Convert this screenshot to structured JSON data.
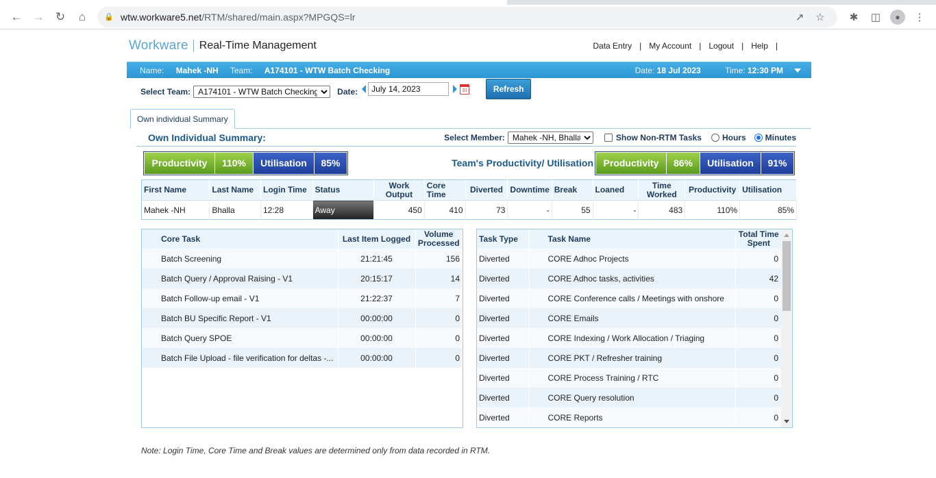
{
  "browser": {
    "url_host": "wtw.workware5.net",
    "url_path": "/RTM/shared/main.aspx?MPGQS=lr"
  },
  "header": {
    "logo": "Workware",
    "product": "Real-Time Management",
    "nav": [
      "Data Entry",
      "My Account",
      "Logout",
      "Help"
    ]
  },
  "infobar": {
    "name_label": "Name:",
    "name_value": "Mahek -NH",
    "team_label": "Team:",
    "team_value": "A174101 - WTW Batch Checking",
    "date_label": "Date:",
    "date_value": "18 Jul 2023",
    "time_label": "Time:",
    "time_value": "12:30 PM"
  },
  "filters": {
    "team_label": "Select Team:",
    "team_value": "A174101 - WTW Batch Checking",
    "date_label": "Date:",
    "date_value": "July 14, 2023",
    "calendar_day": "31",
    "refresh_label": "Refresh"
  },
  "tab": {
    "label": "Own individual Summary"
  },
  "summary": {
    "title": "Own Individual Summary:",
    "member_label": "Select Member:",
    "member_value": "Mahek -NH, Bhalla",
    "non_rtm_label": "Show Non-RTM Tasks",
    "hours_label": "Hours",
    "minutes_label": "Minutes"
  },
  "kpi": {
    "own": {
      "prod_label": "Productivity",
      "prod_value": "110%",
      "util_label": "Utilisation",
      "util_value": "85%"
    },
    "team_label": "Team's Productivity/ Utilisation",
    "team": {
      "prod_label": "Productivity",
      "prod_value": "86%",
      "util_label": "Utilisation",
      "util_value": "91%"
    }
  },
  "main_table": {
    "headers": [
      "First Name",
      "Last Name",
      "Login Time",
      "Status",
      "Work Output",
      "Core Time",
      "Diverted",
      "Downtime",
      "Break",
      "Loaned",
      "Time Worked",
      "Productivity",
      "Utilisation"
    ],
    "row": [
      "Mahek -NH",
      "Bhalla",
      "12:28",
      "Away",
      "450",
      "410",
      "73",
      "-",
      "55",
      "-",
      "483",
      "110%",
      "85%"
    ]
  },
  "core_tasks": {
    "headers": [
      "Core Task",
      "Last Item Logged",
      "Volume Processed"
    ],
    "rows": [
      [
        "Batch Screening",
        "21:21:45",
        "156"
      ],
      [
        "Batch Query / Approval Raising - V1",
        "20:15:17",
        "14"
      ],
      [
        "Batch Follow-up email - V1",
        "21:22:37",
        "7"
      ],
      [
        "Batch BU Specific Report - V1",
        "00:00:00",
        "0"
      ],
      [
        "Batch Query SPOE",
        "00:00:00",
        "0"
      ],
      [
        "Batch File Upload - file verification for deltas -...",
        "00:00:00",
        "0"
      ]
    ]
  },
  "diverted_tasks": {
    "headers": [
      "Task Type",
      "Task Name",
      "Total Time Spent"
    ],
    "rows": [
      [
        "Diverted",
        "CORE Adhoc Projects",
        "0"
      ],
      [
        "Diverted",
        "CORE Adhoc tasks, activities",
        "42"
      ],
      [
        "Diverted",
        "CORE Conference calls / Meetings with onshore",
        "0"
      ],
      [
        "Diverted",
        "CORE Emails",
        "0"
      ],
      [
        "Diverted",
        "CORE Indexing / Work Allocation / Triaging",
        "0"
      ],
      [
        "Diverted",
        "CORE PKT / Refresher training",
        "0"
      ],
      [
        "Diverted",
        "CORE Process Training / RTC",
        "0"
      ],
      [
        "Diverted",
        "CORE Query resolution",
        "0"
      ],
      [
        "Diverted",
        "CORE Reports",
        "0"
      ]
    ]
  },
  "footer_note": "Note: Login Time, Core Time and Break values are determined only from data recorded in RTM."
}
